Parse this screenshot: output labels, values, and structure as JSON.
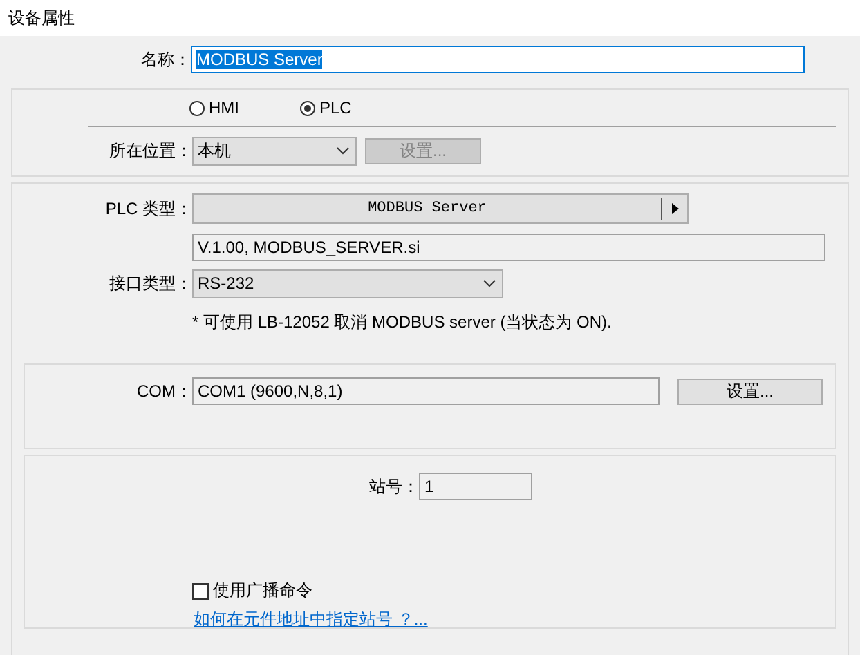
{
  "window": {
    "title": "设备属性"
  },
  "name": {
    "label": "名称：",
    "value": "MODBUS Server",
    "selected": true
  },
  "location_type": {
    "options": [
      {
        "label": "HMI",
        "selected": false
      },
      {
        "label": "PLC",
        "selected": true
      }
    ]
  },
  "location": {
    "label": "所在位置：",
    "value": "本机",
    "button": {
      "label": "设置...",
      "disabled": true
    }
  },
  "plc_type": {
    "label": "PLC 类型：",
    "value": "MODBUS Server"
  },
  "driver_info": "V.1.00, MODBUS_SERVER.si",
  "interface": {
    "label": "接口类型：",
    "value": "RS-232"
  },
  "note": "* 可使用 LB-12052 取消 MODBUS server (当状态为 ON).",
  "com": {
    "label": "COM：",
    "value": "COM1 (9600,N,8,1)",
    "button": "设置..."
  },
  "station": {
    "label": "站号：",
    "value": "1"
  },
  "broadcast": {
    "label": "使用广播命令",
    "checked": false
  },
  "help_link": "如何在元件地址中指定站号 ？..."
}
